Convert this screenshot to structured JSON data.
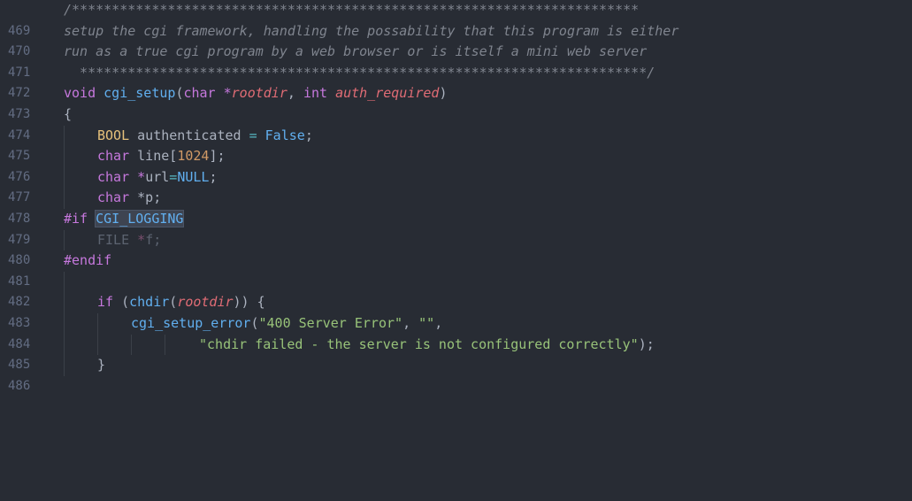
{
  "editor": {
    "lines": [
      {
        "n": "469",
        "t": "/***********************************************************************"
      },
      {
        "n": "470",
        "t": "setup the cgi framework, handling the possability that this program is either"
      },
      {
        "n": "471",
        "t": "run as a true cgi program by a web browser or is itself a mini web server"
      },
      {
        "n": "472",
        "t": "  ***********************************************************************/"
      },
      {
        "n": "473",
        "t1": "void",
        "t2": "cgi_setup",
        "t3": "(",
        "t4": "char",
        "t5": " *",
        "t6": "rootdir",
        "t7": ", ",
        "t8": "int",
        "t9": " ",
        "t10": "auth_required",
        "t11": ")"
      },
      {
        "n": "474",
        "t": "{"
      },
      {
        "n": "475",
        "t1": "BOOL",
        "t2": " authenticated ",
        "t3": "=",
        "t4": " False",
        "t5": ";"
      },
      {
        "n": "476",
        "t1": "char",
        "t2": " line[",
        "t3": "1024",
        "t4": "];"
      },
      {
        "n": "477",
        "t1": "char",
        "t2": " *",
        "t3": "url",
        "t4": "=",
        "t5": "NULL",
        "t6": ";"
      },
      {
        "n": "478",
        "t1": "char",
        "t2": " *p;"
      },
      {
        "n": "479",
        "t1": "#if",
        "t2": "CGI_LOGGING"
      },
      {
        "n": "480",
        "t1": "FILE",
        "t2": " *",
        "t3": "f;"
      },
      {
        "n": "481",
        "t": "#endif"
      },
      {
        "n": "482",
        "t": ""
      },
      {
        "n": "483",
        "t1": "if",
        "t2": " (",
        "t3": "chdir",
        "t4": "(",
        "t5": "rootdir",
        "t6": ")) {"
      },
      {
        "n": "484",
        "t1": "cgi_setup_error",
        "t2": "(",
        "t3": "\"400 Server Error\"",
        "t4": ", ",
        "t5": "\"\"",
        "t6": ","
      },
      {
        "n": "485",
        "t1": "\"chdir failed - the server is not configured correctly\"",
        "t2": ");"
      },
      {
        "n": "486",
        "t": "}"
      }
    ]
  },
  "colors": {
    "background": "#282c34",
    "keyword": "#c678dd",
    "function": "#61afef",
    "type": "#e5c07b",
    "string": "#98c379",
    "number": "#d19a66",
    "comment": "#7f848e"
  }
}
